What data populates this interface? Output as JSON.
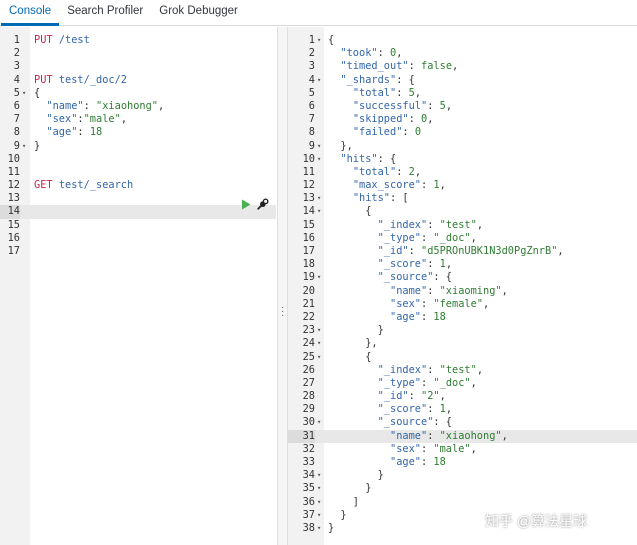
{
  "tabs": [
    {
      "label": "Console",
      "active": true
    },
    {
      "label": "Search Profiler",
      "active": false
    },
    {
      "label": "Grok Debugger",
      "active": false
    }
  ],
  "request": {
    "lines": [
      {
        "n": "1",
        "fold": "",
        "tokens": [
          [
            "m",
            "PUT"
          ],
          [
            "p",
            " "
          ],
          [
            "u",
            "/test"
          ]
        ]
      },
      {
        "n": "2",
        "fold": "",
        "tokens": []
      },
      {
        "n": "3",
        "fold": "",
        "tokens": []
      },
      {
        "n": "4",
        "fold": "",
        "tokens": [
          [
            "m",
            "PUT"
          ],
          [
            "p",
            " "
          ],
          [
            "u",
            "test/_doc/2"
          ]
        ]
      },
      {
        "n": "5",
        "fold": "▾",
        "tokens": [
          [
            "p",
            "{"
          ]
        ]
      },
      {
        "n": "6",
        "fold": "",
        "tokens": [
          [
            "p",
            "  "
          ],
          [
            "k",
            "\"name\""
          ],
          [
            "p",
            ": "
          ],
          [
            "s",
            "\"xiaohong\""
          ],
          [
            "p",
            ","
          ]
        ]
      },
      {
        "n": "7",
        "fold": "",
        "tokens": [
          [
            "p",
            "  "
          ],
          [
            "k",
            "\"sex\""
          ],
          [
            "p",
            ":"
          ],
          [
            "s",
            "\"male\""
          ],
          [
            "p",
            ","
          ]
        ]
      },
      {
        "n": "8",
        "fold": "",
        "tokens": [
          [
            "p",
            "  "
          ],
          [
            "k",
            "\"age\""
          ],
          [
            "p",
            ": "
          ],
          [
            "n",
            "18"
          ]
        ]
      },
      {
        "n": "9",
        "fold": "▾",
        "tokens": [
          [
            "p",
            "}"
          ]
        ]
      },
      {
        "n": "10",
        "fold": "",
        "tokens": []
      },
      {
        "n": "11",
        "fold": "",
        "tokens": []
      },
      {
        "n": "12",
        "fold": "",
        "tokens": [
          [
            "m",
            "GET"
          ],
          [
            "p",
            " "
          ],
          [
            "u",
            "test/_search"
          ]
        ]
      },
      {
        "n": "13",
        "fold": "",
        "tokens": []
      },
      {
        "n": "14",
        "fold": "",
        "tokens": []
      },
      {
        "n": "15",
        "fold": "",
        "tokens": []
      },
      {
        "n": "16",
        "fold": "",
        "tokens": []
      },
      {
        "n": "17",
        "fold": "",
        "tokens": []
      }
    ],
    "active_line": 14
  },
  "response": {
    "lines": [
      {
        "n": "1",
        "fold": "▾",
        "tokens": [
          [
            "p",
            "{"
          ]
        ]
      },
      {
        "n": "2",
        "fold": "",
        "tokens": [
          [
            "p",
            "  "
          ],
          [
            "k",
            "\"took\""
          ],
          [
            "p",
            ": "
          ],
          [
            "n",
            "0"
          ],
          [
            "p",
            ","
          ]
        ]
      },
      {
        "n": "3",
        "fold": "",
        "tokens": [
          [
            "p",
            "  "
          ],
          [
            "k",
            "\"timed_out\""
          ],
          [
            "p",
            ": "
          ],
          [
            "n",
            "false"
          ],
          [
            "p",
            ","
          ]
        ]
      },
      {
        "n": "4",
        "fold": "▾",
        "tokens": [
          [
            "p",
            "  "
          ],
          [
            "k",
            "\"_shards\""
          ],
          [
            "p",
            ": {"
          ]
        ]
      },
      {
        "n": "5",
        "fold": "",
        "tokens": [
          [
            "p",
            "    "
          ],
          [
            "k",
            "\"total\""
          ],
          [
            "p",
            ": "
          ],
          [
            "n",
            "5"
          ],
          [
            "p",
            ","
          ]
        ]
      },
      {
        "n": "6",
        "fold": "",
        "tokens": [
          [
            "p",
            "    "
          ],
          [
            "k",
            "\"successful\""
          ],
          [
            "p",
            ": "
          ],
          [
            "n",
            "5"
          ],
          [
            "p",
            ","
          ]
        ]
      },
      {
        "n": "7",
        "fold": "",
        "tokens": [
          [
            "p",
            "    "
          ],
          [
            "k",
            "\"skipped\""
          ],
          [
            "p",
            ": "
          ],
          [
            "n",
            "0"
          ],
          [
            "p",
            ","
          ]
        ]
      },
      {
        "n": "8",
        "fold": "",
        "tokens": [
          [
            "p",
            "    "
          ],
          [
            "k",
            "\"failed\""
          ],
          [
            "p",
            ": "
          ],
          [
            "n",
            "0"
          ]
        ]
      },
      {
        "n": "9",
        "fold": "▾",
        "tokens": [
          [
            "p",
            "  },"
          ]
        ]
      },
      {
        "n": "10",
        "fold": "▾",
        "tokens": [
          [
            "p",
            "  "
          ],
          [
            "k",
            "\"hits\""
          ],
          [
            "p",
            ": {"
          ]
        ]
      },
      {
        "n": "11",
        "fold": "",
        "tokens": [
          [
            "p",
            "    "
          ],
          [
            "k",
            "\"total\""
          ],
          [
            "p",
            ": "
          ],
          [
            "n",
            "2"
          ],
          [
            "p",
            ","
          ]
        ]
      },
      {
        "n": "12",
        "fold": "",
        "tokens": [
          [
            "p",
            "    "
          ],
          [
            "k",
            "\"max_score\""
          ],
          [
            "p",
            ": "
          ],
          [
            "n",
            "1"
          ],
          [
            "p",
            ","
          ]
        ]
      },
      {
        "n": "13",
        "fold": "▾",
        "tokens": [
          [
            "p",
            "    "
          ],
          [
            "k",
            "\"hits\""
          ],
          [
            "p",
            ": ["
          ]
        ]
      },
      {
        "n": "14",
        "fold": "▾",
        "tokens": [
          [
            "p",
            "      {"
          ]
        ]
      },
      {
        "n": "15",
        "fold": "",
        "tokens": [
          [
            "p",
            "        "
          ],
          [
            "k",
            "\"_index\""
          ],
          [
            "p",
            ": "
          ],
          [
            "s",
            "\"test\""
          ],
          [
            "p",
            ","
          ]
        ]
      },
      {
        "n": "16",
        "fold": "",
        "tokens": [
          [
            "p",
            "        "
          ],
          [
            "k",
            "\"_type\""
          ],
          [
            "p",
            ": "
          ],
          [
            "s",
            "\"_doc\""
          ],
          [
            "p",
            ","
          ]
        ]
      },
      {
        "n": "17",
        "fold": "",
        "tokens": [
          [
            "p",
            "        "
          ],
          [
            "k",
            "\"_id\""
          ],
          [
            "p",
            ": "
          ],
          [
            "s",
            "\"d5PROnUBK1N3d0PgZnrB\""
          ],
          [
            "p",
            ","
          ]
        ]
      },
      {
        "n": "18",
        "fold": "",
        "tokens": [
          [
            "p",
            "        "
          ],
          [
            "k",
            "\"_score\""
          ],
          [
            "p",
            ": "
          ],
          [
            "n",
            "1"
          ],
          [
            "p",
            ","
          ]
        ]
      },
      {
        "n": "19",
        "fold": "▾",
        "tokens": [
          [
            "p",
            "        "
          ],
          [
            "k",
            "\"_source\""
          ],
          [
            "p",
            ": {"
          ]
        ]
      },
      {
        "n": "20",
        "fold": "",
        "tokens": [
          [
            "p",
            "          "
          ],
          [
            "k",
            "\"name\""
          ],
          [
            "p",
            ": "
          ],
          [
            "s",
            "\"xiaoming\""
          ],
          [
            "p",
            ","
          ]
        ]
      },
      {
        "n": "21",
        "fold": "",
        "tokens": [
          [
            "p",
            "          "
          ],
          [
            "k",
            "\"sex\""
          ],
          [
            "p",
            ": "
          ],
          [
            "s",
            "\"female\""
          ],
          [
            "p",
            ","
          ]
        ]
      },
      {
        "n": "22",
        "fold": "",
        "tokens": [
          [
            "p",
            "          "
          ],
          [
            "k",
            "\"age\""
          ],
          [
            "p",
            ": "
          ],
          [
            "n",
            "18"
          ]
        ]
      },
      {
        "n": "23",
        "fold": "▾",
        "tokens": [
          [
            "p",
            "        }"
          ]
        ]
      },
      {
        "n": "24",
        "fold": "▾",
        "tokens": [
          [
            "p",
            "      },"
          ]
        ]
      },
      {
        "n": "25",
        "fold": "▾",
        "tokens": [
          [
            "p",
            "      {"
          ]
        ]
      },
      {
        "n": "26",
        "fold": "",
        "tokens": [
          [
            "p",
            "        "
          ],
          [
            "k",
            "\"_index\""
          ],
          [
            "p",
            ": "
          ],
          [
            "s",
            "\"test\""
          ],
          [
            "p",
            ","
          ]
        ]
      },
      {
        "n": "27",
        "fold": "",
        "tokens": [
          [
            "p",
            "        "
          ],
          [
            "k",
            "\"_type\""
          ],
          [
            "p",
            ": "
          ],
          [
            "s",
            "\"_doc\""
          ],
          [
            "p",
            ","
          ]
        ]
      },
      {
        "n": "28",
        "fold": "",
        "tokens": [
          [
            "p",
            "        "
          ],
          [
            "k",
            "\"_id\""
          ],
          [
            "p",
            ": "
          ],
          [
            "s",
            "\"2\""
          ],
          [
            "p",
            ","
          ]
        ]
      },
      {
        "n": "29",
        "fold": "",
        "tokens": [
          [
            "p",
            "        "
          ],
          [
            "k",
            "\"_score\""
          ],
          [
            "p",
            ": "
          ],
          [
            "n",
            "1"
          ],
          [
            "p",
            ","
          ]
        ]
      },
      {
        "n": "30",
        "fold": "▾",
        "tokens": [
          [
            "p",
            "        "
          ],
          [
            "k",
            "\"_source\""
          ],
          [
            "p",
            ": {"
          ]
        ]
      },
      {
        "n": "31",
        "fold": "",
        "tokens": [
          [
            "p",
            "          "
          ],
          [
            "k",
            "\"name\""
          ],
          [
            "p",
            ": "
          ],
          [
            "s",
            "\"xiaohong\""
          ],
          [
            "p",
            ","
          ]
        ]
      },
      {
        "n": "32",
        "fold": "",
        "tokens": [
          [
            "p",
            "          "
          ],
          [
            "k",
            "\"sex\""
          ],
          [
            "p",
            ": "
          ],
          [
            "s",
            "\"male\""
          ],
          [
            "p",
            ","
          ]
        ]
      },
      {
        "n": "33",
        "fold": "",
        "tokens": [
          [
            "p",
            "          "
          ],
          [
            "k",
            "\"age\""
          ],
          [
            "p",
            ": "
          ],
          [
            "n",
            "18"
          ]
        ]
      },
      {
        "n": "34",
        "fold": "▾",
        "tokens": [
          [
            "p",
            "        }"
          ]
        ]
      },
      {
        "n": "35",
        "fold": "▾",
        "tokens": [
          [
            "p",
            "      }"
          ]
        ]
      },
      {
        "n": "36",
        "fold": "▾",
        "tokens": [
          [
            "p",
            "    ]"
          ]
        ]
      },
      {
        "n": "37",
        "fold": "▾",
        "tokens": [
          [
            "p",
            "  }"
          ]
        ]
      },
      {
        "n": "38",
        "fold": "▾",
        "tokens": [
          [
            "p",
            "}"
          ]
        ]
      }
    ],
    "active_line": 31
  },
  "actions": {
    "run_icon": "play-icon",
    "settings_icon": "wrench-icon",
    "run_color": "#4caf50"
  },
  "divider_icon": "vertical-grip-icon",
  "watermark": "知乎 @算法星球"
}
